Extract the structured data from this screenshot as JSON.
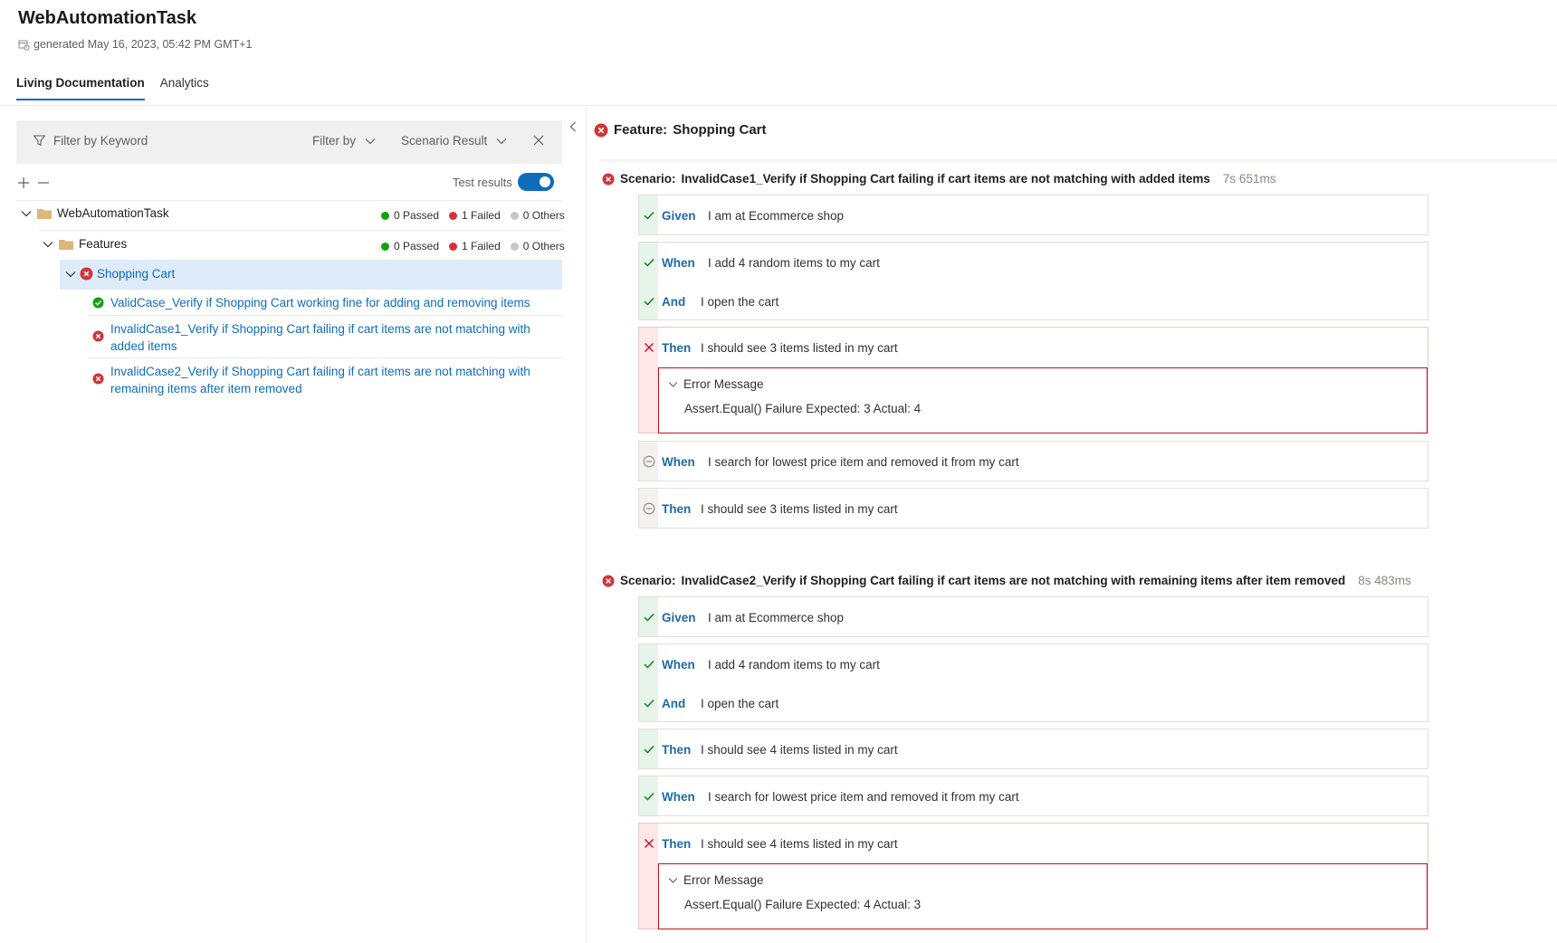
{
  "header": {
    "title": "WebAutomationTask",
    "generated": "generated May 16, 2023, 05:42 PM GMT+1"
  },
  "tabs": [
    {
      "label": "Living Documentation",
      "active": true
    },
    {
      "label": "Analytics",
      "active": false
    }
  ],
  "filters": {
    "keyword_placeholder": "Filter by Keyword",
    "filter_by": "Filter by",
    "scenario_result": "Scenario Result",
    "test_results_label": "Test results",
    "test_results_on": true
  },
  "tree": {
    "root": {
      "label": "WebAutomationTask",
      "passed": "0 Passed",
      "failed": "1 Failed",
      "others": "0 Others"
    },
    "features": {
      "label": "Features",
      "passed": "0 Passed",
      "failed": "1 Failed",
      "others": "0 Others"
    },
    "feature": {
      "label": "Shopping Cart"
    },
    "scenarios": [
      {
        "label": "ValidCase_Verify if Shopping Cart working fine for adding and removing items",
        "status": "passed"
      },
      {
        "label_line1": "InvalidCase1_Verify if Shopping Cart failing if cart items are not matching with",
        "label_line2": "added items",
        "status": "failed"
      },
      {
        "label_line1": "InvalidCase2_Verify if Shopping Cart failing if cart items are not matching with",
        "label_line2": "remaining items after item removed",
        "status": "failed"
      }
    ]
  },
  "feature_detail": {
    "label": "Feature:",
    "name": "Shopping Cart",
    "scenarios": [
      {
        "label": "Scenario:",
        "name": "InvalidCase1_Verify if Shopping Cart failing if cart items are not matching with added items",
        "duration": "7s 651ms",
        "steps": [
          {
            "keyword": "Given",
            "text": "I am at Ecommerce shop",
            "status": "passed"
          },
          {
            "keyword": "When",
            "text": "I add 4 random items to my cart",
            "status": "passed"
          },
          {
            "keyword": "And",
            "text": "I open the cart",
            "status": "passed"
          },
          {
            "keyword": "Then",
            "text": "I should see 3 items listed in my cart",
            "status": "failed",
            "error_title": "Error Message",
            "error_message": "Assert.Equal() Failure Expected: 3 Actual: 4"
          },
          {
            "keyword": "When",
            "text": "I search for lowest price item and removed it from my cart",
            "status": "skipped"
          },
          {
            "keyword": "Then",
            "text": "I should see 3 items listed in my cart",
            "status": "skipped"
          }
        ]
      },
      {
        "label": "Scenario:",
        "name": "InvalidCase2_Verify if Shopping Cart failing if cart items are not matching with remaining items after item removed",
        "duration": "8s 483ms",
        "steps": [
          {
            "keyword": "Given",
            "text": "I am at Ecommerce shop",
            "status": "passed"
          },
          {
            "keyword": "When",
            "text": "I add 4 random items to my cart",
            "status": "passed"
          },
          {
            "keyword": "And",
            "text": "I open the cart",
            "status": "passed"
          },
          {
            "keyword": "Then",
            "text": "I should see 4 items listed in my cart",
            "status": "passed"
          },
          {
            "keyword": "When",
            "text": "I search for lowest price item and removed it from my cart",
            "status": "passed"
          },
          {
            "keyword": "Then",
            "text": "I should see 4 items listed in my cart",
            "status": "failed",
            "error_title": "Error Message",
            "error_message": "Assert.Equal() Failure Expected: 4 Actual: 3"
          }
        ]
      }
    ]
  },
  "colors": {
    "accent": "#0f6cbd",
    "passed": "#107c10",
    "failed": "#c50f1f",
    "others": "#c8c6c4",
    "keyword": "#1f6aa5"
  }
}
